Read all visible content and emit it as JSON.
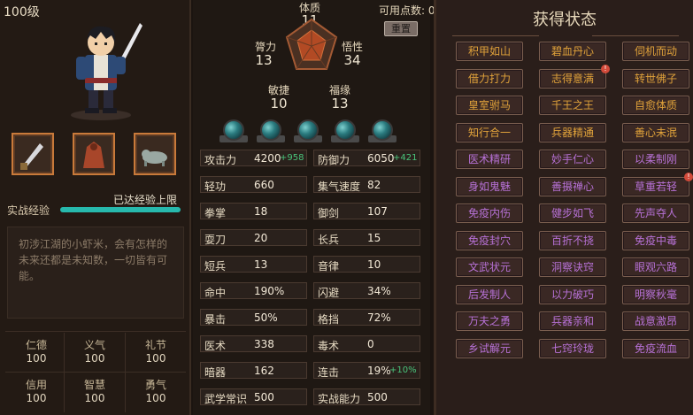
{
  "left": {
    "level": "100级",
    "items": [
      {
        "name": "sword-icon"
      },
      {
        "name": "cloak-icon"
      },
      {
        "name": "beast-icon"
      }
    ],
    "exp_label": "实战经验",
    "exp_status": "已达经验上限",
    "exp_progress": 1.0,
    "bio": "初涉江湖的小虾米，会有怎样的未来还都是未知数，一切皆有可能。",
    "virtues": [
      {
        "name": "仁德",
        "value": "100"
      },
      {
        "name": "义气",
        "value": "100"
      },
      {
        "name": "礼节",
        "value": "100"
      },
      {
        "name": "信用",
        "value": "100"
      },
      {
        "name": "智慧",
        "value": "100"
      },
      {
        "name": "勇气",
        "value": "100"
      }
    ]
  },
  "mid": {
    "available_points": "可用点数: 0",
    "reset_label": "重置",
    "attributes": [
      {
        "name": "体质",
        "value": "11"
      },
      {
        "name": "膂力",
        "value": "13"
      },
      {
        "name": "悟性",
        "value": "34"
      },
      {
        "name": "敏捷",
        "value": "10"
      },
      {
        "name": "福缘",
        "value": "13"
      }
    ],
    "stats": [
      {
        "name": "攻击力",
        "value": "4200",
        "bonus": "+958"
      },
      {
        "name": "防御力",
        "value": "6050",
        "bonus": "+421"
      },
      {
        "name": "轻功",
        "value": "660",
        "bonus": ""
      },
      {
        "name": "集气速度",
        "value": "82",
        "bonus": ""
      },
      {
        "name": "拳掌",
        "value": "18",
        "bonus": ""
      },
      {
        "name": "御剑",
        "value": "107",
        "bonus": ""
      },
      {
        "name": "耍刀",
        "value": "20",
        "bonus": ""
      },
      {
        "name": "长兵",
        "value": "15",
        "bonus": ""
      },
      {
        "name": "短兵",
        "value": "13",
        "bonus": ""
      },
      {
        "name": "音律",
        "value": "10",
        "bonus": ""
      },
      {
        "name": "命中",
        "value": "190%",
        "bonus": ""
      },
      {
        "name": "闪避",
        "value": "34%",
        "bonus": ""
      },
      {
        "name": "暴击",
        "value": "50%",
        "bonus": ""
      },
      {
        "name": "格挡",
        "value": "72%",
        "bonus": ""
      },
      {
        "name": "医术",
        "value": "338",
        "bonus": ""
      },
      {
        "name": "毒术",
        "value": "0",
        "bonus": ""
      },
      {
        "name": "暗器",
        "value": "162",
        "bonus": ""
      },
      {
        "name": "连击",
        "value": "19%",
        "bonus": "+10%"
      },
      {
        "name": "武学常识",
        "value": "500",
        "bonus": ""
      },
      {
        "name": "实战能力",
        "value": "500",
        "bonus": ""
      }
    ]
  },
  "right": {
    "title": "获得状态",
    "tags": [
      {
        "label": "积甲如山",
        "color": "#e0a23a",
        "badge": ""
      },
      {
        "label": "碧血丹心",
        "color": "#e0a23a",
        "badge": ""
      },
      {
        "label": "伺机而动",
        "color": "#e0a23a",
        "badge": ""
      },
      {
        "label": "借力打力",
        "color": "#e0a23a",
        "badge": ""
      },
      {
        "label": "志得意满",
        "color": "#e0a23a",
        "badge": "!"
      },
      {
        "label": "转世佛子",
        "color": "#e0a23a",
        "badge": ""
      },
      {
        "label": "皇室驸马",
        "color": "#e0a23a",
        "badge": ""
      },
      {
        "label": "千王之王",
        "color": "#e0a23a",
        "badge": ""
      },
      {
        "label": "自愈体质",
        "color": "#e0a23a",
        "badge": ""
      },
      {
        "label": "知行合一",
        "color": "#e0a23a",
        "badge": ""
      },
      {
        "label": "兵器精通",
        "color": "#e0a23a",
        "badge": ""
      },
      {
        "label": "善心未泯",
        "color": "#e0a23a",
        "badge": ""
      },
      {
        "label": "医术精研",
        "color": "#b771d6",
        "badge": ""
      },
      {
        "label": "妙手仁心",
        "color": "#b771d6",
        "badge": ""
      },
      {
        "label": "以柔制刚",
        "color": "#b771d6",
        "badge": ""
      },
      {
        "label": "身如鬼魅",
        "color": "#b771d6",
        "badge": ""
      },
      {
        "label": "善摄禅心",
        "color": "#b771d6",
        "badge": ""
      },
      {
        "label": "草重若轻",
        "color": "#b771d6",
        "badge": "!"
      },
      {
        "label": "免疫内伤",
        "color": "#b771d6",
        "badge": ""
      },
      {
        "label": "健步如飞",
        "color": "#b771d6",
        "badge": ""
      },
      {
        "label": "先声夺人",
        "color": "#b771d6",
        "badge": ""
      },
      {
        "label": "免疫封穴",
        "color": "#b771d6",
        "badge": ""
      },
      {
        "label": "百折不挠",
        "color": "#b771d6",
        "badge": ""
      },
      {
        "label": "免疫中毒",
        "color": "#b771d6",
        "badge": ""
      },
      {
        "label": "文武状元",
        "color": "#b771d6",
        "badge": ""
      },
      {
        "label": "洞察诀窍",
        "color": "#b771d6",
        "badge": ""
      },
      {
        "label": "眼观六路",
        "color": "#b771d6",
        "badge": ""
      },
      {
        "label": "后发制人",
        "color": "#b771d6",
        "badge": ""
      },
      {
        "label": "以力破巧",
        "color": "#b771d6",
        "badge": ""
      },
      {
        "label": "明察秋毫",
        "color": "#b771d6",
        "badge": ""
      },
      {
        "label": "万夫之勇",
        "color": "#b771d6",
        "badge": ""
      },
      {
        "label": "兵器亲和",
        "color": "#b771d6",
        "badge": ""
      },
      {
        "label": "战意激昂",
        "color": "#b771d6",
        "badge": ""
      },
      {
        "label": "乡试解元",
        "color": "#b771d6",
        "badge": ""
      },
      {
        "label": "七窍玲珑",
        "color": "#b771d6",
        "badge": ""
      },
      {
        "label": "免疫流血",
        "color": "#b771d6",
        "badge": ""
      }
    ]
  }
}
